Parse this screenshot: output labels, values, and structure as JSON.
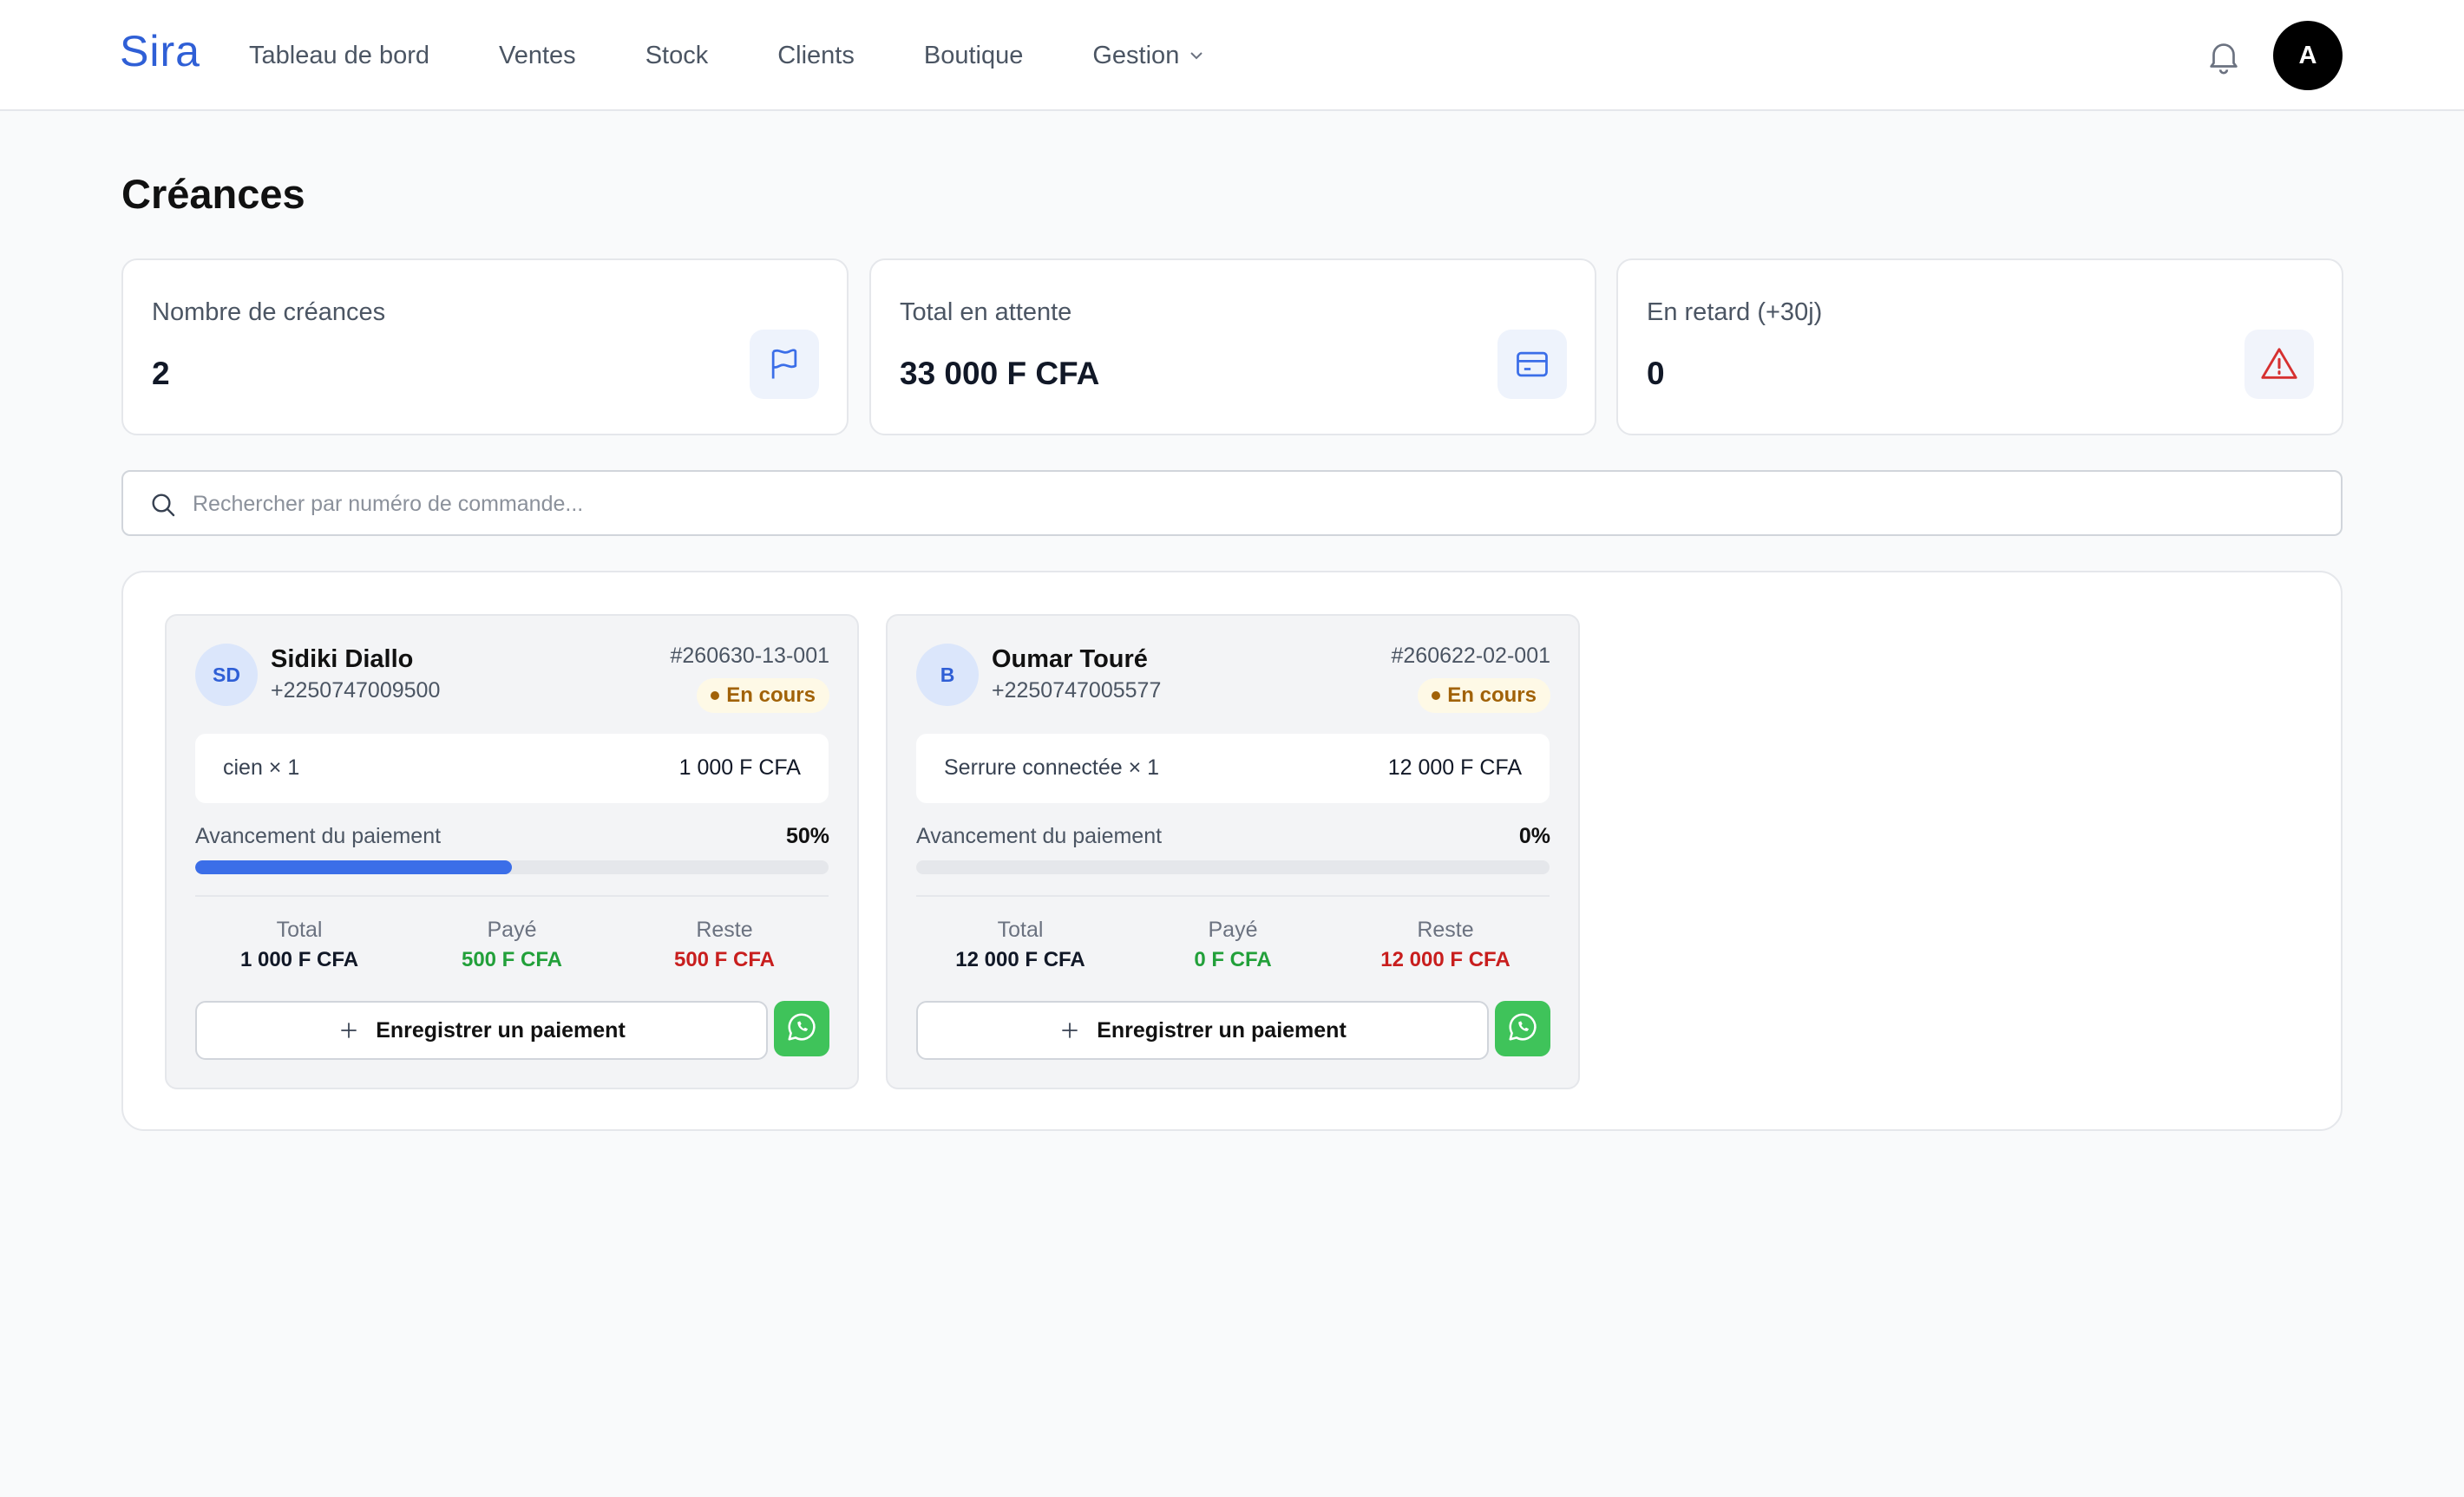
{
  "app": {
    "logo": "Sira"
  },
  "nav": [
    {
      "label": "Tableau de bord"
    },
    {
      "label": "Ventes"
    },
    {
      "label": "Stock"
    },
    {
      "label": "Clients"
    },
    {
      "label": "Boutique"
    },
    {
      "label": "Gestion"
    }
  ],
  "header": {
    "bell_icon": "bell-icon",
    "avatar_letter": "A"
  },
  "page": {
    "title": "Créances"
  },
  "stats": [
    {
      "label": "Nombre de créances",
      "value": "2",
      "icon": "flag-icon"
    },
    {
      "label": "Total en attente",
      "value": "33 000 F CFA",
      "icon": "credit-card-icon"
    },
    {
      "label": "En retard (+30j)",
      "value": "0",
      "icon": "warning-triangle-icon"
    }
  ],
  "search": {
    "placeholder": "Rechercher par numéro de commande...",
    "value": ""
  },
  "cards": [
    {
      "initials": "SD",
      "name": "Sidiki Diallo",
      "phone": "+2250747009500",
      "order": "#260630-13-001",
      "status": "En cours",
      "item_name": "cien × 1",
      "item_price": "1 000 F CFA",
      "progress_label": "Avancement du paiement",
      "progress_text": "50%",
      "progress": 0.5,
      "total_label": "Total",
      "total": "1 000 F CFA",
      "paid_label": "Payé",
      "paid": "500 F CFA",
      "rest_label": "Reste",
      "rest": "500 F CFA",
      "button": "Enregistrer un paiement"
    },
    {
      "initials": "B",
      "name": "Oumar Touré",
      "phone": "+2250747005577",
      "order": "#260622-02-001",
      "status": "En cours",
      "item_name": "Serrure connectée × 1",
      "item_price": "12 000 F CFA",
      "progress_label": "Avancement du paiement",
      "progress_text": "0%",
      "progress": 0,
      "total_label": "Total",
      "total": "12 000 F CFA",
      "paid_label": "Payé",
      "paid": "0 F CFA",
      "rest_label": "Reste",
      "rest": "12 000 F CFA",
      "button": "Enregistrer un paiement"
    }
  ],
  "colors": {
    "brand": "#2f5fd6",
    "progress": "#3b6ee8",
    "paid": "#22a03a",
    "rest": "#c81e1e",
    "whatsapp": "#3fc35a",
    "badge": "#a16207"
  }
}
